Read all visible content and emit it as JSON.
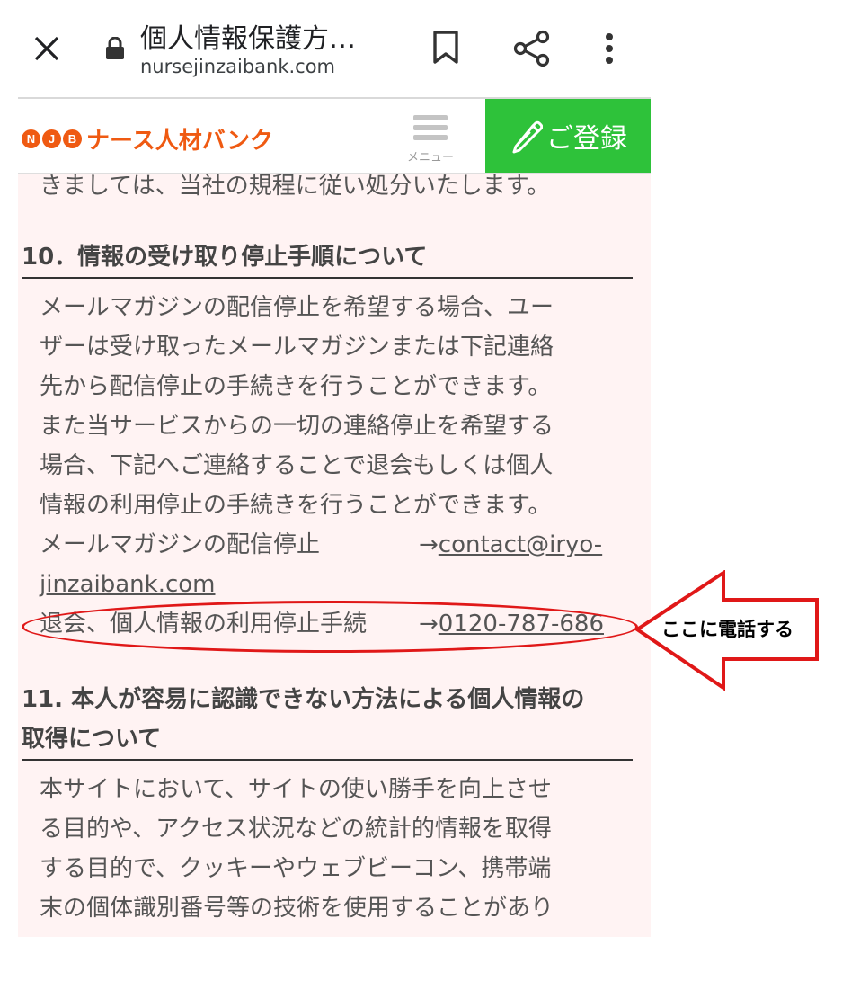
{
  "browser": {
    "title": "個人情報保護方…",
    "url": "nursejinzaibank.com"
  },
  "site": {
    "logo_badges": [
      "N",
      "J",
      "B"
    ],
    "logo_text": "ナース人材バンク",
    "menu_label": "メニュー",
    "register_label": "ご登録"
  },
  "content": {
    "cut_line": "きましては、当社の規程に従い処分いたします。",
    "section10": {
      "title": "10．情報の受け取り停止手順について",
      "lines": [
        "メールマガジンの配信停止を希望する場合、ユー",
        "ザーは受け取ったメールマガジンまたは下記連絡",
        "先から配信停止の手続きを行うことができます。",
        "また当サービスからの一切の連絡停止を希望する",
        "場合、下記へご連絡することで退会もしくは個人",
        "情報の利用停止の手続きを行うことができます。"
      ],
      "mail_label": "メールマガジンの配信停止",
      "mail_arrow": "→",
      "mail_link_a": "contact@iryo-",
      "mail_link_b": "jinzaibank.com",
      "phone_label": "退会、個人情報の利用停止手続",
      "phone_arrow": "→",
      "phone_link": "0120-787-686"
    },
    "section11": {
      "title_line1": "11. 本人が容易に認識できない方法による個人情報の",
      "title_line2": "取得について",
      "lines": [
        "本サイトにおいて、サイトの使い勝手を向上させ",
        "る目的や、アクセス状況などの統計的情報を取得",
        "する目的で、クッキーやウェブビーコン、携帯端",
        "末の個体識別番号等の技術を使用することがあり"
      ]
    }
  },
  "annotation": {
    "callout_text": "ここに電話する",
    "color": "#e01818"
  }
}
